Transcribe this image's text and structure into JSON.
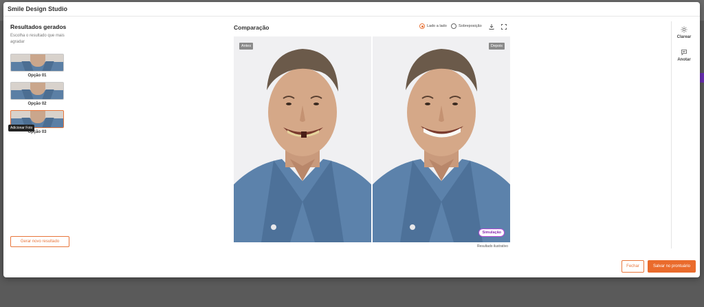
{
  "modal": {
    "title": "Smile Design Studio"
  },
  "left": {
    "title": "Resultados gerados",
    "subtitle": "Escolha o resultado que mais agradar",
    "options": [
      {
        "label": "Opção 01",
        "selected": false
      },
      {
        "label": "Opção 02",
        "selected": false
      },
      {
        "label": "Opção 03",
        "selected": true
      }
    ],
    "tooltip": "Adicionar Foto",
    "generate_button": "Gerar novo resultado"
  },
  "comparison": {
    "title": "Comparação",
    "view_modes": [
      {
        "label": "Lado a lado",
        "selected": true
      },
      {
        "label": "Sobreposição",
        "selected": false
      }
    ],
    "before_tag": "Antes",
    "after_tag": "Depois",
    "simulation_badge": "Simulação",
    "disclaimer": "Resultado ilustrativo"
  },
  "rail": {
    "items": [
      {
        "label": "Clarear",
        "icon": "sun-icon"
      },
      {
        "label": "Anotar",
        "icon": "comment-icon"
      }
    ]
  },
  "footer": {
    "close_label": "Fechar",
    "save_label": "Salvar no prontuário"
  },
  "colors": {
    "accent": "#ea6b2c",
    "badge": "#8b2db0",
    "shirt": "#5b7fa5"
  }
}
